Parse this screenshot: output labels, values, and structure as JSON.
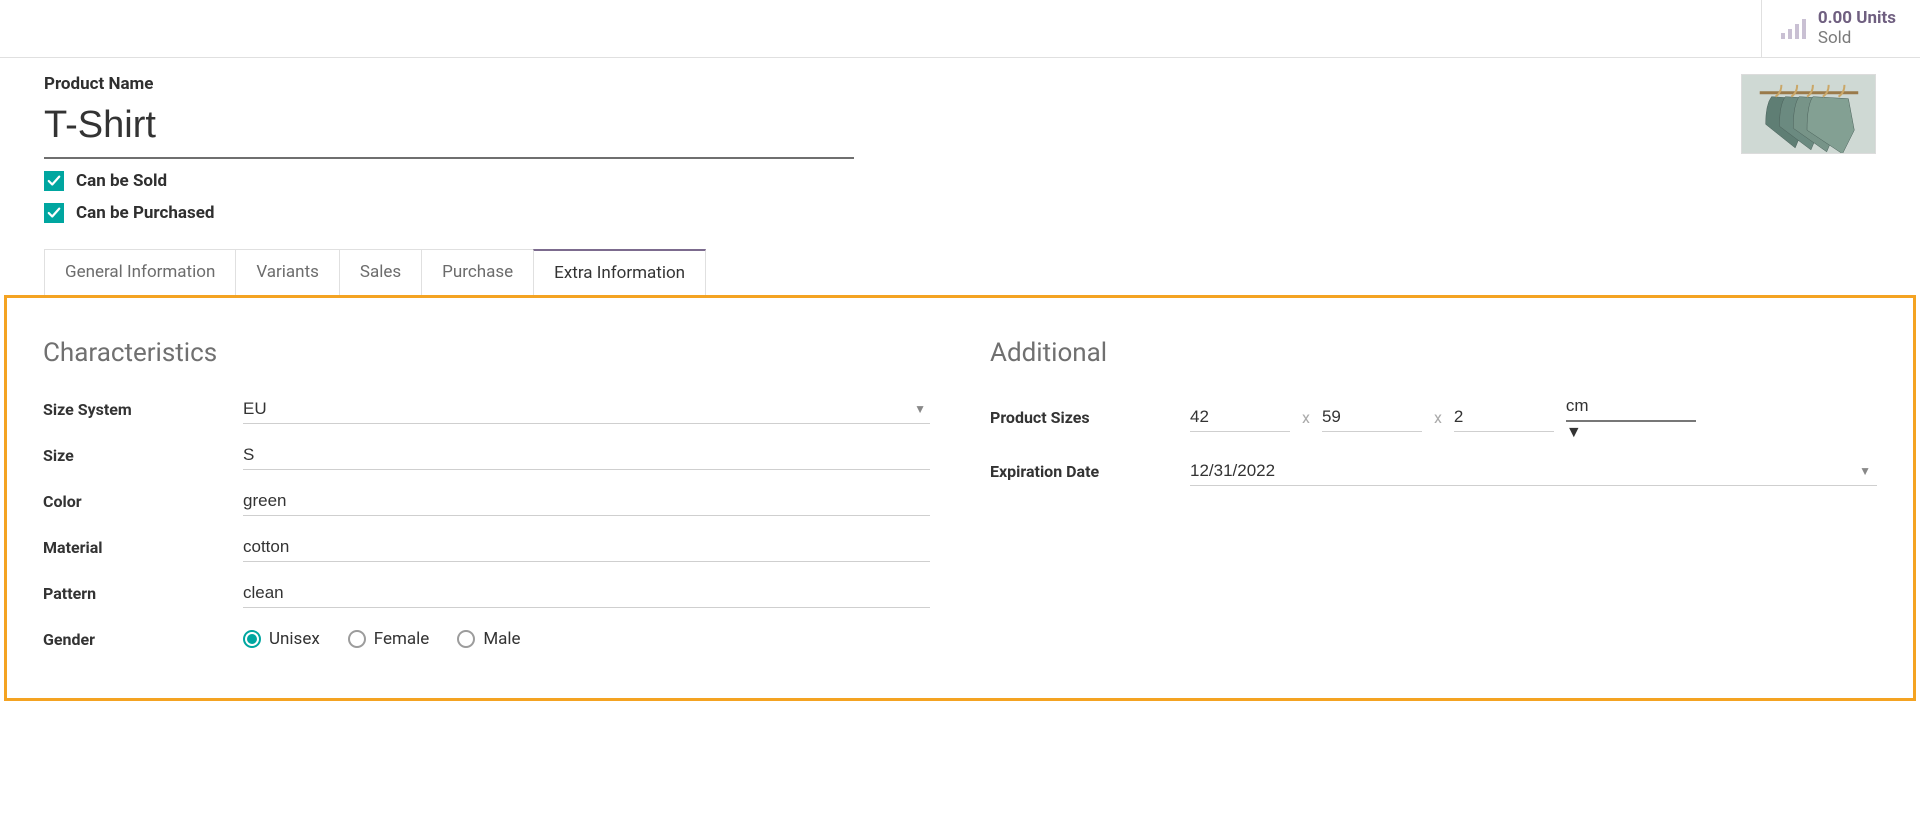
{
  "header": {
    "stat_value": "0.00 Units",
    "stat_label": "Sold"
  },
  "product": {
    "name_label": "Product Name",
    "name": "T-Shirt",
    "can_be_sold_label": "Can be Sold",
    "can_be_sold": true,
    "can_be_purchased_label": "Can be Purchased",
    "can_be_purchased": true
  },
  "tabs": [
    {
      "label": "General Information",
      "active": false
    },
    {
      "label": "Variants",
      "active": false
    },
    {
      "label": "Sales",
      "active": false
    },
    {
      "label": "Purchase",
      "active": false
    },
    {
      "label": "Extra Information",
      "active": true
    }
  ],
  "characteristics": {
    "section_title": "Characteristics",
    "size_system_label": "Size System",
    "size_system": "EU",
    "size_label": "Size",
    "size": "S",
    "color_label": "Color",
    "color": "green",
    "material_label": "Material",
    "material": "cotton",
    "pattern_label": "Pattern",
    "pattern": "clean",
    "gender_label": "Gender",
    "gender_options": [
      "Unisex",
      "Female",
      "Male"
    ],
    "gender_selected": "Unisex"
  },
  "additional": {
    "section_title": "Additional",
    "product_sizes_label": "Product Sizes",
    "dim1": "42",
    "dim2": "59",
    "dim3": "2",
    "unit": "cm",
    "expiration_label": "Expiration Date",
    "expiration": "12/31/2022",
    "sep": "x"
  },
  "colors": {
    "accent": "#00a6a0",
    "highlight": "#f4a322",
    "purple": "#7c6b8e"
  }
}
